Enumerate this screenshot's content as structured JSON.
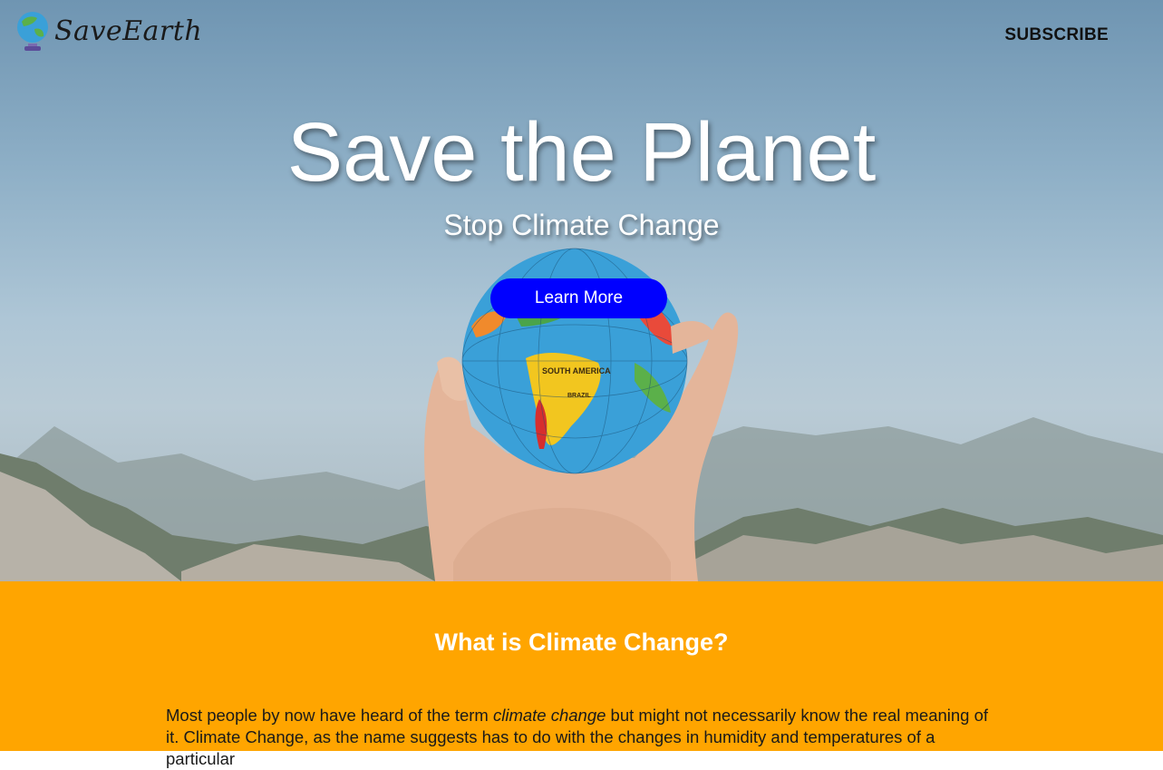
{
  "navbar": {
    "logo_text": "SaveEarth",
    "logo_icon": "globe-icon",
    "subscribe_label": "SUBSCRIBE"
  },
  "hero": {
    "title": "Save the Planet",
    "subtitle": "Stop Climate Change",
    "cta_label": "Learn More",
    "globe_labels": {
      "south_america": "SOUTH AMERICA",
      "brazil": "BRAZIL"
    }
  },
  "about": {
    "title": "What is Climate Change?",
    "para_start": "Most people by now have heard of the term ",
    "para_emph": "climate change",
    "para_end": " but might not necessarily know the real meaning of it. Climate Change, as the name suggests has to do with the changes in humidity and temperatures of a particular"
  },
  "colors": {
    "cta_background": "#0000ff",
    "section_background": "#ffa500",
    "hero_text": "#ffffff"
  }
}
